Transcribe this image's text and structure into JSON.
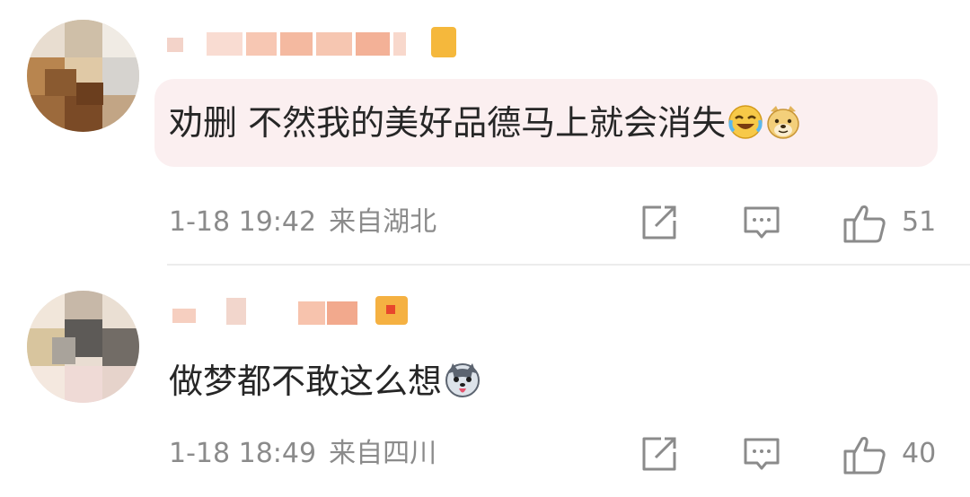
{
  "comments": [
    {
      "text": "劝删 不然我的美好品德马上就会消失",
      "emoji": [
        "laugh-cry-emoji",
        "doge-emoji"
      ],
      "time": "1-18 19:42",
      "location": "来自湖北",
      "likes": "51"
    },
    {
      "text": "做梦都不敢这么想",
      "emoji": [
        "husky-emoji"
      ],
      "time": "1-18 18:49",
      "location": "来自四川",
      "likes": "40"
    }
  ],
  "icons": {
    "share": "share-icon",
    "comment": "comment-icon",
    "like": "thumbs-up-icon"
  },
  "colors": {
    "bubble": "#fbeff0",
    "meta_text": "#8b8b8b",
    "body_text": "#262626"
  }
}
